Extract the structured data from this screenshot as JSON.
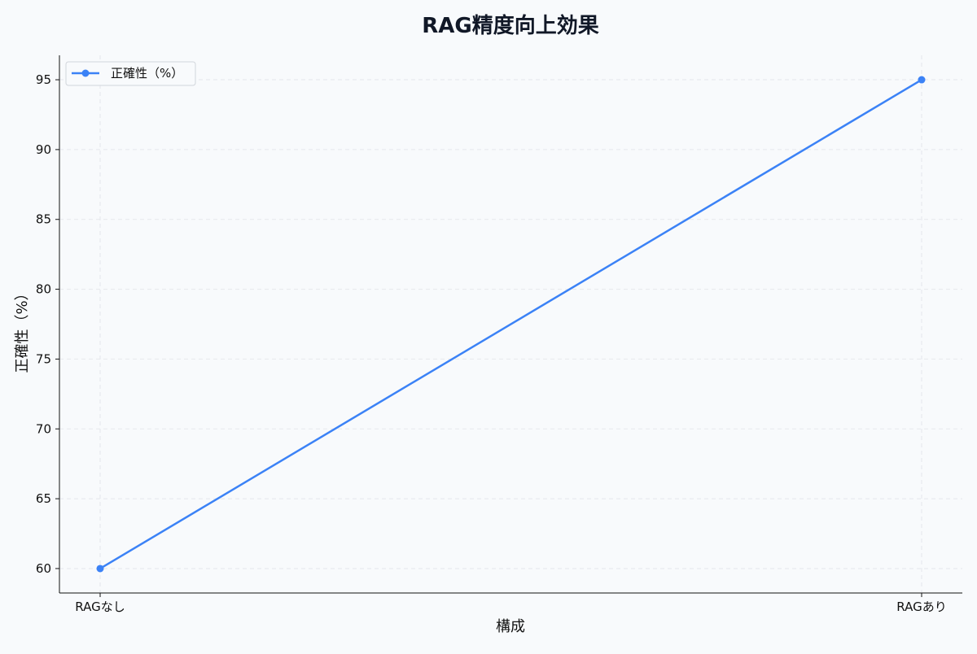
{
  "chart_data": {
    "type": "line",
    "title": "RAG精度向上効果",
    "xlabel": "構成",
    "ylabel": "正確性（%）",
    "categories": [
      "RAGなし",
      "RAGあり"
    ],
    "series": [
      {
        "name": "正確性（%）",
        "values": [
          60,
          95
        ],
        "color": "#3b82f6"
      }
    ],
    "ylim": [
      58.25,
      96.75
    ],
    "yticks": [
      60,
      65,
      70,
      75,
      80,
      85,
      90,
      95
    ],
    "grid": true,
    "legend": "top-left",
    "colors": {
      "background": "#f8fafc",
      "line": "#3b82f6",
      "grid": "#e5e7eb",
      "axis": "#111111",
      "title": "#111827"
    }
  }
}
